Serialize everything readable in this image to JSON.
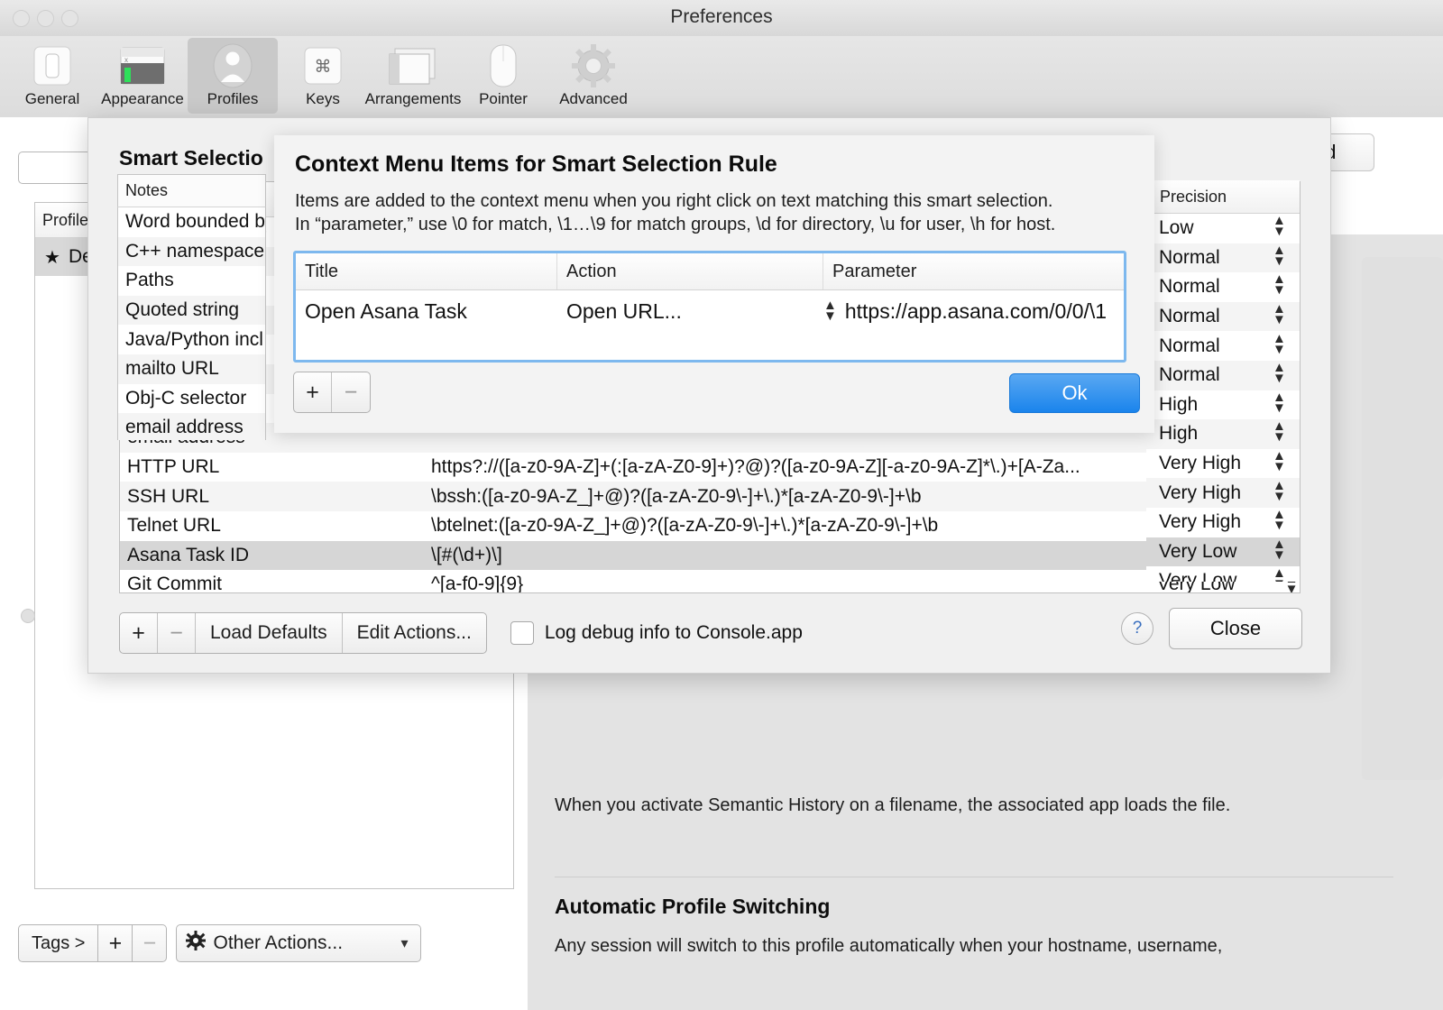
{
  "window": {
    "title": "Preferences",
    "traffic_lights": [
      "close",
      "minimize",
      "zoom"
    ]
  },
  "toolbar": {
    "items": [
      {
        "label": "General",
        "icon": "switch-icon",
        "selected": false
      },
      {
        "label": "Appearance",
        "icon": "terminal-window-icon",
        "selected": false
      },
      {
        "label": "Profiles",
        "icon": "person-icon",
        "selected": true
      },
      {
        "label": "Keys",
        "icon": "command-key-icon",
        "selected": false
      },
      {
        "label": "Arrangements",
        "icon": "windows-icon",
        "selected": false
      },
      {
        "label": "Pointer",
        "icon": "mouse-icon",
        "selected": false
      },
      {
        "label": "Advanced",
        "icon": "gear-icon",
        "selected": false
      }
    ]
  },
  "background": {
    "search_placeholder": "",
    "profiles_column_header": "Profile",
    "profile_rows": [
      {
        "star": "★",
        "name": "De"
      }
    ],
    "tags_bar": {
      "tags_label": "Tags >",
      "add_label": "+",
      "remove_label": "−",
      "other_actions_label": "Other Actions...",
      "gear_icon": "gear-icon",
      "caret_icon": "chevron-down-icon"
    },
    "semantic_history_text": "When you activate Semantic History on a filename, the associated app loads the file.",
    "automatic_profile_switching_heading": "Automatic Profile Switching",
    "automatic_profile_switching_text": "Any session will switch to this profile automatically when your hostname, username,",
    "edit_tab_fragment": "ed",
    "clipped_fragment": "l"
  },
  "smart_selection_sheet": {
    "title": "Smart Selectio",
    "columns": {
      "notes": "Notes",
      "precision": "Precision"
    },
    "rows": [
      {
        "name": "Word bounded b",
        "regex": "",
        "precision": "Low",
        "selected": false
      },
      {
        "name": "C++ namespace",
        "regex": "",
        "precision": "Normal",
        "selected": false
      },
      {
        "name": "Paths",
        "regex": "",
        "precision": "Normal",
        "selected": false
      },
      {
        "name": "Quoted string",
        "regex": "",
        "precision": "Normal",
        "selected": false
      },
      {
        "name": "Java/Python incl",
        "regex": "",
        "precision": "Normal",
        "selected": false
      },
      {
        "name": "mailto URL",
        "regex": "",
        "precision": "Normal",
        "selected": false
      },
      {
        "name": "Obj-C selector",
        "regex": "",
        "precision": "High",
        "selected": false
      },
      {
        "name": "email address",
        "regex": "",
        "precision": "High",
        "selected": false
      },
      {
        "name": "HTTP URL",
        "regex": "https?://([a-z0-9A-Z]+(:[a-zA-Z0-9]+)?@)?([a-z0-9A-Z][-a-z0-9A-Z]*\\.)+[A-Za...",
        "precision": "Very High",
        "selected": false
      },
      {
        "name": "SSH URL",
        "regex": "\\bssh:([a-z0-9A-Z_]+@)?([a-zA-Z0-9\\-]+\\.)*[a-zA-Z0-9\\-]+\\b",
        "precision": "Very High",
        "selected": false
      },
      {
        "name": "Telnet URL",
        "regex": "\\btelnet:([a-z0-9A-Z_]+@)?([a-zA-Z0-9\\-]+\\.)*[a-zA-Z0-9\\-]+\\b",
        "precision": "Very High",
        "selected": false
      },
      {
        "name": "Asana Task ID",
        "regex": "\\[#(\\d+)\\]",
        "precision": "Very Low",
        "selected": true
      },
      {
        "name": "Git Commit",
        "regex": "^[a-f0-9]{9}",
        "precision": "Very Low",
        "selected": false
      }
    ],
    "footer": {
      "add_label": "+",
      "remove_label": "−",
      "load_defaults_label": "Load Defaults",
      "edit_actions_label": "Edit Actions...",
      "log_debug_label": "Log debug info to Console.app",
      "log_debug_checked": false,
      "help_label": "?",
      "close_label": "Close"
    }
  },
  "context_menu_dialog": {
    "title": "Context Menu Items for Smart Selection Rule",
    "description_line_1": "Items are added to the context menu when you right click on text matching this smart selection.",
    "description_line_2": "In “parameter,” use \\0 for match, \\1…\\9 for match groups, \\d for directory, \\u for user, \\h for host.",
    "columns": {
      "title": "Title",
      "action": "Action",
      "parameter": "Parameter"
    },
    "rows": [
      {
        "title": "Open Asana Task",
        "action": "Open URL...",
        "parameter": "https://app.asana.com/0/0/\\1"
      }
    ],
    "add_label": "+",
    "remove_label": "−",
    "ok_label": "Ok"
  },
  "colors": {
    "accent_blue": "#1a84ec",
    "focus_ring": "#7db8ee",
    "selection_gray": "#d6d6d6",
    "sheet_bg": "#f0f0f0",
    "dialog_bg": "#f3f3f3",
    "right_pane_bg": "#e3e3e3",
    "toolbar_bg": "#e0e0e0"
  }
}
